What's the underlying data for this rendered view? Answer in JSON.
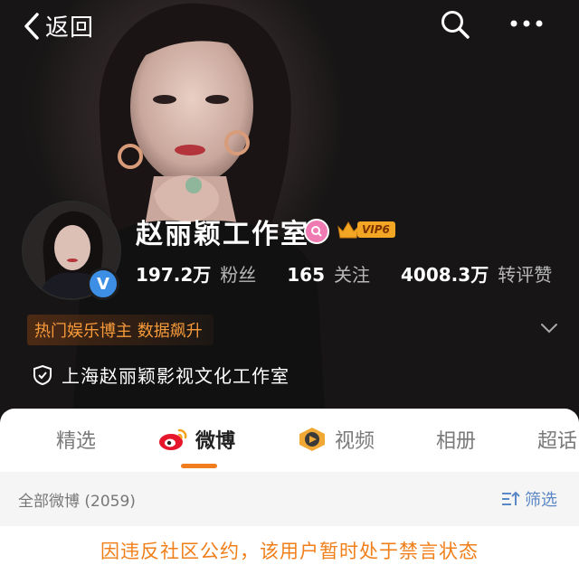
{
  "topbar": {
    "back_label": "返回"
  },
  "profile": {
    "name": "赵丽颖工作室",
    "vip_level": "VIP6",
    "stats": [
      {
        "value": "197.2万",
        "label": "粉丝"
      },
      {
        "value": "165",
        "label": "关注"
      },
      {
        "value": "4008.3万",
        "label": "转评赞"
      }
    ],
    "hot_tag": "热门娱乐博主 数据飙升",
    "organization": "上海赵丽颖影视文化工作室"
  },
  "tabs": [
    {
      "label": "精选"
    },
    {
      "label": "微博"
    },
    {
      "label": "视频"
    },
    {
      "label": "相册"
    },
    {
      "label": "超话"
    }
  ],
  "feed": {
    "all_label": "全部微博 (2059)",
    "filter_label": "筛选",
    "notice": "因违反社区公约，该用户暂时处于禁言状态"
  },
  "colors": {
    "accent": "#f27d1e",
    "notice": "#f07f1a",
    "link": "#5a87c6"
  }
}
